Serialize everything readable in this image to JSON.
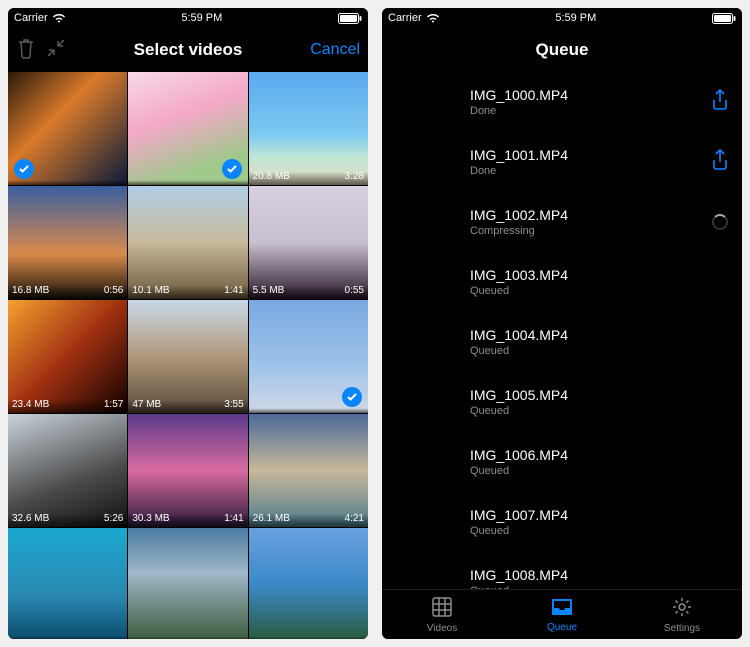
{
  "status": {
    "carrier": "Carrier",
    "time": "5:59 PM"
  },
  "left": {
    "title": "Select videos",
    "cancel": "Cancel",
    "cells": [
      {
        "size": "",
        "dur": "",
        "thumb": "city-night",
        "check": "bl"
      },
      {
        "size": "",
        "dur": "",
        "thumb": "flowers",
        "check": "br"
      },
      {
        "size": "20.8 MB",
        "dur": "3:28",
        "thumb": "beach-palm"
      },
      {
        "size": "16.8 MB",
        "dur": "0:56",
        "thumb": "jump-sunset"
      },
      {
        "size": "10.1 MB",
        "dur": "1:41",
        "thumb": "narrow-street"
      },
      {
        "size": "5.5 MB",
        "dur": "0:55",
        "thumb": "taj-mahal"
      },
      {
        "size": "23.4 MB",
        "dur": "1:57",
        "thumb": "pizza-fire"
      },
      {
        "size": "47 MB",
        "dur": "3:55",
        "thumb": "rome-city"
      },
      {
        "size": "",
        "dur": "",
        "thumb": "balloons",
        "check": "br"
      },
      {
        "size": "32.6 MB",
        "dur": "5:26",
        "thumb": "driving"
      },
      {
        "size": "30.3 MB",
        "dur": "1:41",
        "thumb": "pink-sunset"
      },
      {
        "size": "26.1 MB",
        "dur": "4:21",
        "thumb": "venice"
      },
      {
        "size": "",
        "dur": "",
        "thumb": "pier-water"
      },
      {
        "size": "",
        "dur": "",
        "thumb": "mountains"
      },
      {
        "size": "",
        "dur": "",
        "thumb": "coast"
      }
    ]
  },
  "right": {
    "title": "Queue",
    "items": [
      {
        "name": "IMG_1000.MP4",
        "status": "Done",
        "thumb": "city-night",
        "action": "share"
      },
      {
        "name": "IMG_1001.MP4",
        "status": "Done",
        "thumb": "flowers",
        "action": "share"
      },
      {
        "name": "IMG_1002.MP4",
        "status": "Compressing",
        "thumb": "beach-palm",
        "action": "spinner"
      },
      {
        "name": "IMG_1003.MP4",
        "status": "Queued",
        "thumb": "jump-sunset"
      },
      {
        "name": "IMG_1004.MP4",
        "status": "Queued",
        "thumb": "narrow-street"
      },
      {
        "name": "IMG_1005.MP4",
        "status": "Queued",
        "thumb": "taj-mahal"
      },
      {
        "name": "IMG_1006.MP4",
        "status": "Queued",
        "thumb": "pizza-fire"
      },
      {
        "name": "IMG_1007.MP4",
        "status": "Queued",
        "thumb": "rome-city"
      },
      {
        "name": "IMG_1008.MP4",
        "status": "Queued",
        "thumb": "balloons"
      }
    ],
    "tabs": [
      {
        "name": "Videos",
        "icon": "grid"
      },
      {
        "name": "Queue",
        "icon": "inbox",
        "active": true
      },
      {
        "name": "Settings",
        "icon": "gear"
      }
    ]
  },
  "thumbs": {
    "city-night": "linear-gradient(135deg,#2a1a0a,#d97a2a 40%,#0a1a3a)",
    "flowers": "linear-gradient(160deg,#f7d9e8,#f3a8c8 40%,#9ec98a 80%)",
    "beach-palm": "linear-gradient(180deg,#5aa8f0 0%,#7cc9f0 55%,#bfe6d6 75%,#e8dcc0 100%)",
    "jump-sunset": "linear-gradient(180deg,#3a5fa0 0%,#d98a4a 60%,#1a120a 100%)",
    "narrow-street": "linear-gradient(180deg,#b0cfe8 0%,#c8b89a 50%,#6a5a3a 100%)",
    "taj-mahal": "linear-gradient(180deg,#d8d0e0 0%,#c8bfd0 50%,#2a1a2a 100%)",
    "pizza-fire": "linear-gradient(135deg,#f6a030,#a03010 50%,#100000)",
    "rome-city": "linear-gradient(180deg,#c8d8e8 0%,#b0987a 50%,#5a4a3a 100%)",
    "balloons": "linear-gradient(180deg,#7aa8e0 0%,#a0c4ea 60%,#d0d8e8 100%)",
    "driving": "linear-gradient(160deg,#cad4dc 0%,#4a4a4a 60%,#101010 100%)",
    "pink-sunset": "linear-gradient(180deg,#5a3a8a 0%,#d96aa0 50%,#2a1a3a 100%)",
    "venice": "linear-gradient(180deg,#4a6a9a 0%,#c8b89a 50%,#4a7a8a 100%)",
    "pier-water": "linear-gradient(180deg,#1aa8d0 0%,#2a88b0 60%,#0a4a6a 100%)",
    "mountains": "linear-gradient(180deg,#4a7aa0 0%,#a0b8c8 40%,#3a5a3a 100%)",
    "coast": "linear-gradient(180deg,#6aa0e0 0%,#3a8ac8 50%,#2a5a3a 100%)"
  }
}
